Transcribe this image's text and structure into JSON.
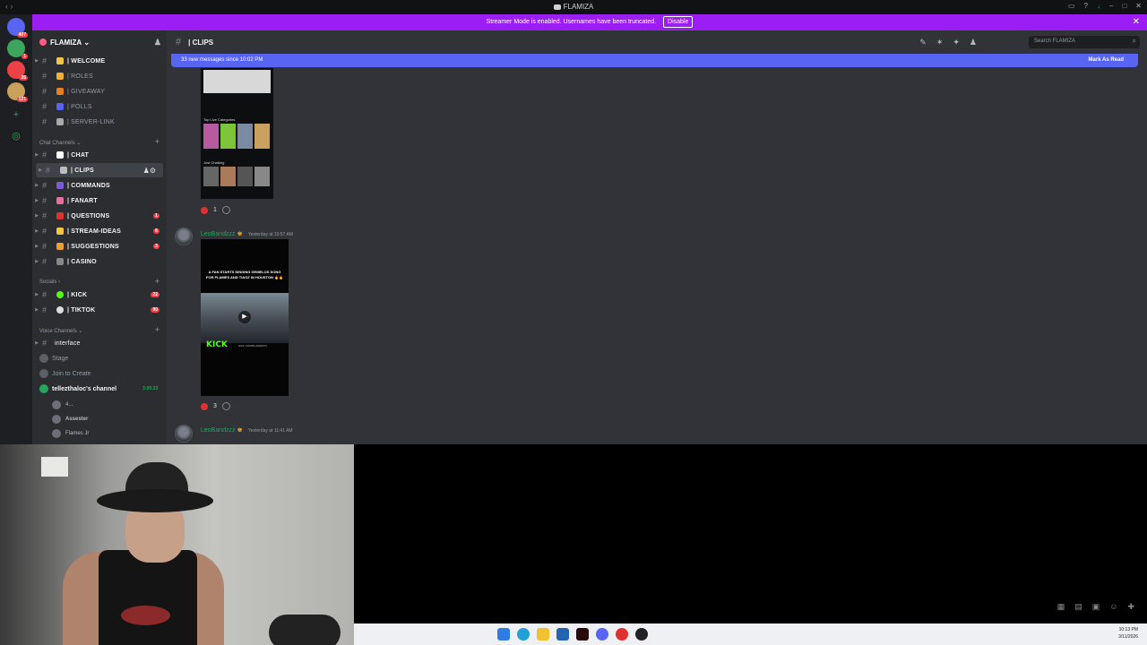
{
  "window": {
    "title": "FLAMIZA"
  },
  "banner": {
    "text": "Streamer Mode is enabled. Usernames have been truncated.",
    "button": "Disable"
  },
  "servers": [
    {
      "badge": "407",
      "color": "#5865f2"
    },
    {
      "badge": "1",
      "color": "#3ba55c"
    },
    {
      "badge": "26",
      "color": "#ed4245"
    },
    {
      "badge": "121",
      "color": "#c9a15a"
    }
  ],
  "guild": {
    "name": "FLAMIZA"
  },
  "channels_top": [
    {
      "name": "| WELCOME",
      "bold": true,
      "color": "#f4c542"
    },
    {
      "name": "| ROLES",
      "bold": false,
      "color": "#f0b232"
    },
    {
      "name": "| GIVEAWAY",
      "bold": false,
      "color": "#e67e22"
    },
    {
      "name": "| POLLS",
      "bold": false,
      "color": "#5865f2"
    },
    {
      "name": "| SERVER-LINK",
      "bold": false,
      "color": "#aaaaaa"
    }
  ],
  "categories": {
    "chat": "Chat Channels",
    "socials": "Socials",
    "voice": "Voice Channels"
  },
  "channels_chat": [
    {
      "name": "| CHAT",
      "color": "#ffffff",
      "count": ""
    },
    {
      "name": "| CLIPS",
      "color": "#bbbbbb",
      "count": "",
      "active": true
    },
    {
      "name": "| COMMANDS",
      "color": "#7b5cd6",
      "count": ""
    },
    {
      "name": "| FANART",
      "color": "#e86fa1",
      "count": ""
    },
    {
      "name": "| QUESTIONS",
      "color": "#e03131",
      "count": "1"
    },
    {
      "name": "| STREAM-IDEAS",
      "color": "#f4c542",
      "count": "6"
    },
    {
      "name": "| SUGGESTIONS",
      "color": "#f0a030",
      "count": "3"
    },
    {
      "name": "| CASINO",
      "color": "#888888",
      "count": ""
    }
  ],
  "channels_social": [
    {
      "name": "| KICK",
      "color": "#53fc18",
      "count": "22"
    },
    {
      "name": "| TIKTOK",
      "color": "#dddddd",
      "count": "90"
    }
  ],
  "voice": {
    "interface": "interface",
    "stage": "Stage",
    "join": "Join to Create",
    "channel": "tellezthaloc's channel",
    "time": "3:09:33",
    "users": [
      "4...",
      "Assester",
      "Flames Jr"
    ]
  },
  "header": {
    "channel": "| CLIPS",
    "search_placeholder": "Search FLAMIZA"
  },
  "newbar": {
    "text": "33 new messages since 10:02 PM",
    "mark": "Mark As Read"
  },
  "messages": [
    {
      "author": "LeoBandzzz",
      "time": "Yesterday at 10:57 AM"
    },
    {
      "author": "LeoBandzzz",
      "time": "Yesterday at 11:41 AM"
    }
  ],
  "clip1": {
    "caption1": "Top Live Categories",
    "caption2": "Just Chatting",
    "reaction_count": "1"
  },
  "clip2": {
    "text": "A FAN STARTS SINGING GEMELOS SONG FOR FLAMES AND TIAGZ IN HOUSTON 🔥🔥",
    "kick": "KICK",
    "url": "KICK.COM/FLAMIZATV",
    "reaction_count": "3"
  },
  "taskbar": {
    "time": "10:13 PM",
    "date": "3/11/2026"
  }
}
